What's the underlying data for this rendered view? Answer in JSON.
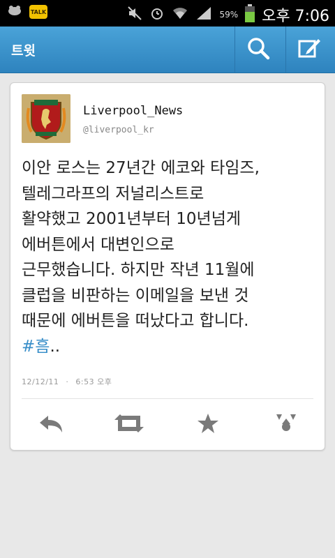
{
  "status_bar": {
    "battery_percent": "59%",
    "time": "오후 7:06",
    "kakao_label": "TALK"
  },
  "app_bar": {
    "title": "트윗"
  },
  "tweet": {
    "author_name": "Liverpool_News",
    "author_handle": "@liverpool_kr",
    "text_lines": [
      "이안 로스는 27년간 에코와 타임즈,",
      "텔레그라프의 저널리스트로",
      "활약했고 2001년부터 10년넘게",
      "에버튼에서 대변인으로",
      "근무했습니다. 하지만 작년 11월에",
      "클럽을 비판하는 이메일을 보낸 것",
      "때문에 에버튼을 떠났다고 합니다."
    ],
    "hashtag": "#흠",
    "trailing": "..",
    "date": "12/12/11",
    "separator": "·",
    "time": "6:53 오후"
  },
  "colors": {
    "app_bar": "#3a94cf",
    "hashtag": "#3a8fc9",
    "action_icons": "#7a7a7a"
  }
}
